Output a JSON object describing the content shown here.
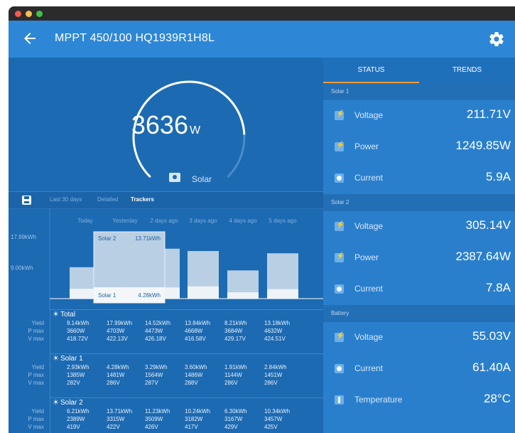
{
  "app": {
    "title": "MPPT 450/100 HQ1939R1H8L"
  },
  "gauge": {
    "value": "3636",
    "unit": "W",
    "label": "Solar",
    "fill_fraction": 0.82
  },
  "history_tabs": [
    "Last 30 days",
    "Detailed",
    "Trackers"
  ],
  "chart_data": {
    "type": "bar",
    "categories": [
      "Today",
      "Yesterday",
      "2 days ago",
      "3 days ago",
      "4 days ago",
      "5 days ago"
    ],
    "y_ticks": [
      "17.99kWh",
      "9.00kWh"
    ],
    "series": [
      {
        "name": "Solar 1",
        "values": [
          2.93,
          4.28,
          3.29,
          3.6,
          1.91,
          2.84
        ]
      },
      {
        "name": "Solar 2",
        "values": [
          6.21,
          13.71,
          11.23,
          10.24,
          6.3,
          10.34
        ]
      }
    ],
    "ylim": [
      0,
      17.99
    ],
    "tooltip": {
      "category": "Yesterday",
      "solar2_label": "Solar 2",
      "solar2_value": "13.71kWh",
      "solar1_label": "Solar 1",
      "solar1_value": "4.28kWh"
    }
  },
  "table": {
    "row_labels": [
      "Yield",
      "P max",
      "V max"
    ],
    "sections": [
      {
        "title": "Total",
        "rows": [
          [
            "9.14kWh",
            "17.99kWh",
            "14.52kWh",
            "13.84kWh",
            "8.21kWh",
            "13.18kWh"
          ],
          [
            "3660W",
            "4703W",
            "4473W",
            "4668W",
            "3684W",
            "4632W"
          ],
          [
            "418.72V",
            "422.13V",
            "426.18V",
            "416.58V",
            "429.17V",
            "424.51V"
          ]
        ]
      },
      {
        "title": "Solar 1",
        "rows": [
          [
            "2.93kWh",
            "4.28kWh",
            "3.29kWh",
            "3.60kWh",
            "1.91kWh",
            "2.84kWh"
          ],
          [
            "1385W",
            "1481W",
            "1564W",
            "1486W",
            "1144W",
            "1451W"
          ],
          [
            "282V",
            "286V",
            "287V",
            "288V",
            "286V",
            "286V"
          ]
        ]
      },
      {
        "title": "Solar 2",
        "rows": [
          [
            "6.21kWh",
            "13.71kWh",
            "11.23kWh",
            "10.24kWh",
            "6.30kWh",
            "10.34kWh"
          ],
          [
            "2389W",
            "3315W",
            "3509W",
            "3182W",
            "3167W",
            "3457W"
          ],
          [
            "419V",
            "422V",
            "426V",
            "417V",
            "429V",
            "425V"
          ]
        ]
      }
    ]
  },
  "status": {
    "tabs": [
      "STATUS",
      "TRENDS"
    ],
    "groups": [
      {
        "title": "Solar 1",
        "rows": [
          {
            "label": "Voltage",
            "value": "211.71V",
            "icon": "bolt"
          },
          {
            "label": "Power",
            "value": "1249.85W",
            "icon": "bolt"
          },
          {
            "label": "Current",
            "value": "5.9A",
            "icon": "circle"
          }
        ]
      },
      {
        "title": "Solar 2",
        "rows": [
          {
            "label": "Voltage",
            "value": "305.14V",
            "icon": "bolt"
          },
          {
            "label": "Power",
            "value": "2387.64W",
            "icon": "bolt"
          },
          {
            "label": "Current",
            "value": "7.8A",
            "icon": "circle"
          }
        ]
      },
      {
        "title": "Battery",
        "rows": [
          {
            "label": "Voltage",
            "value": "55.03V",
            "icon": "bolt"
          },
          {
            "label": "Current",
            "value": "61.40A",
            "icon": "circle"
          },
          {
            "label": "Temperature",
            "value": "28°C",
            "icon": "therm"
          }
        ]
      }
    ]
  },
  "colors": {
    "appbar": "#2d87d6",
    "left_panel": "#1c6ab2",
    "right_panel": "#2a7fcd",
    "tab_indicator": "#f39a3d",
    "bar_solar2": "#b9cfe4",
    "bar_solar1": "#eef3f8"
  }
}
